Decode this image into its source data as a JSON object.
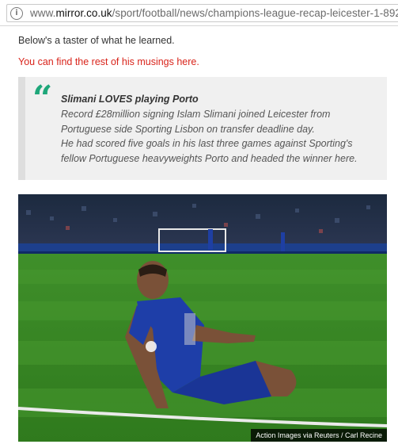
{
  "browser": {
    "url_prefix": "www.",
    "url_host": "mirror.co.uk",
    "url_path": "/sport/football/news/champions-league-recap-leicester-1-892"
  },
  "article": {
    "intro": "Below's a taster of what he learned.",
    "link_text": "You can find the rest of his musings here."
  },
  "quote": {
    "mark": "“",
    "title": "Slimani LOVES playing Porto",
    "lines": [
      "Record £28million signing Islam Slimani joined Leicester from",
      "Portuguese side Sporting Lisbon on transfer deadline day.",
      "He had scored five goals in his last three games against Sporting's",
      "fellow Portuguese heavyweights Porto and headed the winner here."
    ]
  },
  "photo": {
    "caption": "Action Images via Reuters / Carl Recine",
    "accent_color": "#1fa77a",
    "link_color": "#d9241b"
  }
}
